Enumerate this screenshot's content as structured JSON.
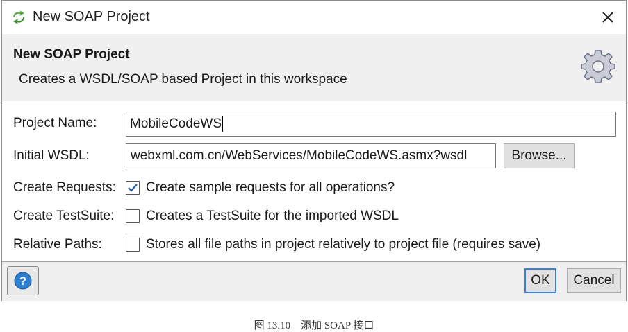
{
  "window": {
    "title": "New SOAP Project",
    "close_icon": "close-icon",
    "app_icon": "soapui-icon"
  },
  "banner": {
    "title": "New SOAP Project",
    "description": "Creates a WSDL/SOAP based Project in this workspace",
    "icon": "gear-icon"
  },
  "form": {
    "project_name_label": "Project Name:",
    "project_name_value": "MobileCodeWS",
    "initial_wsdl_label": "Initial WSDL:",
    "initial_wsdl_value": "webxml.com.cn/WebServices/MobileCodeWS.asmx?wsdl",
    "browse_label": "Browse...",
    "create_requests_label": "Create Requests:",
    "create_requests_option": "Create sample requests for all operations?",
    "create_requests_checked": true,
    "create_testsuite_label": "Create TestSuite:",
    "create_testsuite_option": "Creates a TestSuite for the imported WSDL",
    "create_testsuite_checked": false,
    "relative_paths_label": "Relative Paths:",
    "relative_paths_option": "Stores all file paths in project relatively to project file (requires save)",
    "relative_paths_checked": false
  },
  "footer": {
    "help_icon": "help-icon",
    "ok_label": "OK",
    "cancel_label": "Cancel"
  },
  "caption": "图 13.10　添加 SOAP 接口",
  "colors": {
    "accent": "#2f7fd1",
    "check": "#1f5fae",
    "banner_bg": "#f0f0f0",
    "app_icon_green": "#4caf50"
  }
}
